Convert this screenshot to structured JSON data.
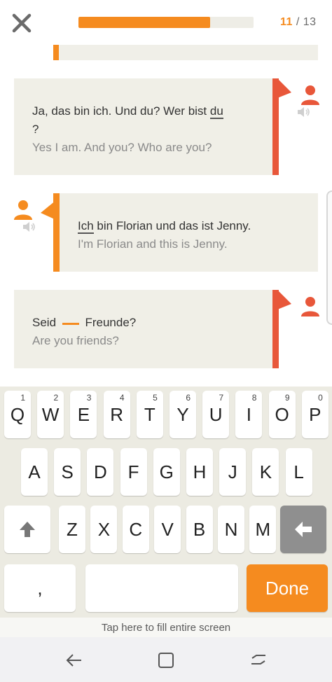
{
  "header": {
    "progress_current": "11",
    "progress_separator": "/",
    "progress_total": "13",
    "progress_fraction": 0.75
  },
  "dialogue": [
    {
      "side": "right",
      "de_parts": [
        "Ja, das bin ich. Und du? Wer bist ",
        "du",
        " ?"
      ],
      "en": "Yes I am. And you? Who are you?"
    },
    {
      "side": "left",
      "de_parts": [
        "Ich",
        " bin Florian und das ist Jenny."
      ],
      "en": "I'm Florian and this is Jenny."
    },
    {
      "side": "right",
      "de_parts": [
        "Seid ",
        " Freunde?"
      ],
      "en": "Are you friends?"
    }
  ],
  "keyboard": {
    "row1": [
      {
        "k": "Q",
        "n": "1"
      },
      {
        "k": "W",
        "n": "2"
      },
      {
        "k": "E",
        "n": "3"
      },
      {
        "k": "R",
        "n": "4"
      },
      {
        "k": "T",
        "n": "5"
      },
      {
        "k": "Y",
        "n": "6"
      },
      {
        "k": "U",
        "n": "7"
      },
      {
        "k": "I",
        "n": "8"
      },
      {
        "k": "O",
        "n": "9"
      },
      {
        "k": "P",
        "n": "0"
      }
    ],
    "row2": [
      "A",
      "S",
      "D",
      "F",
      "G",
      "H",
      "J",
      "K",
      "L"
    ],
    "row3": [
      "Z",
      "X",
      "C",
      "V",
      "B",
      "N",
      "M"
    ],
    "comma": ",",
    "done": "Done"
  },
  "fill_screen_hint": "Tap here to fill entire screen",
  "colors": {
    "accent_orange": "#f58b1f",
    "accent_red": "#e8573a"
  },
  "icons": [
    "close-icon",
    "person-icon",
    "speaker-icon",
    "shift-arrow-icon",
    "backspace-arrow-icon",
    "nav-back-icon",
    "nav-home-icon",
    "nav-recents-icon"
  ]
}
